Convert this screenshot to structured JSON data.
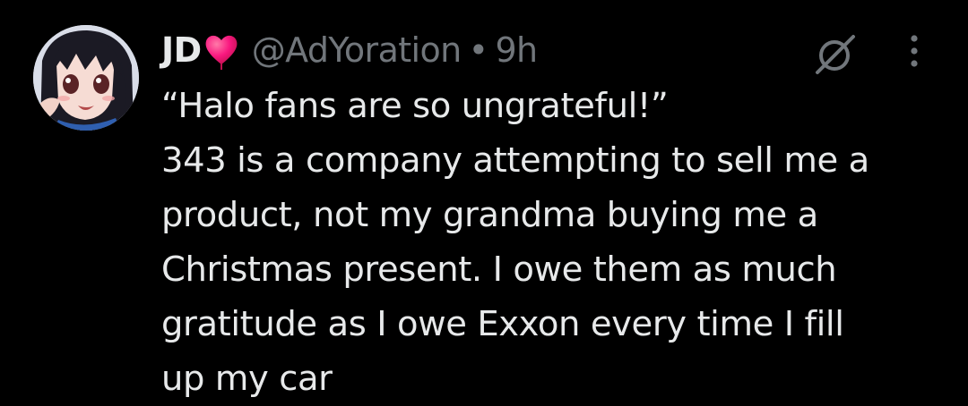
{
  "tweet": {
    "author": {
      "display_name": "JD",
      "badge_icon": "red-heart-icon",
      "handle": "@AdYoration",
      "separator": "•",
      "time": "9h"
    },
    "actions": {
      "grok_icon": "grok-icon",
      "more_icon": "more-options-icon"
    },
    "text_lines": [
      "“Halo fans are so ungrateful!”",
      "343 is a company attempting to sell me a",
      "product, not my grandma buying me a",
      "Christmas present. I owe them as much",
      "gratitude as I owe Exxon every time I fill",
      "up my car"
    ],
    "colors": {
      "background": "#000000",
      "primary_text": "#e7e9ea",
      "secondary_text": "#71767b",
      "heart": "#f91880"
    }
  }
}
